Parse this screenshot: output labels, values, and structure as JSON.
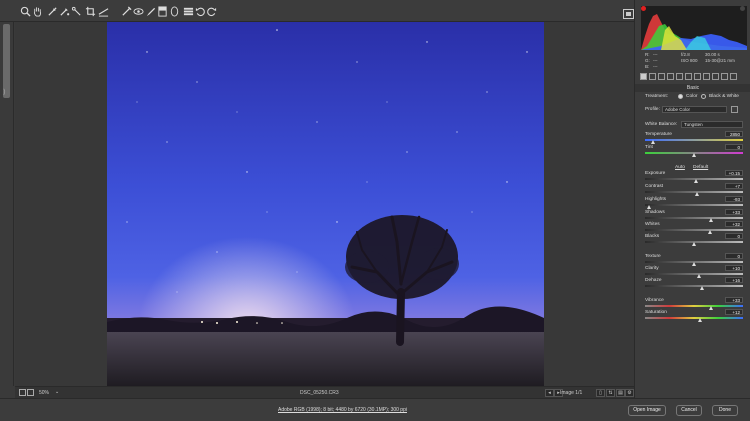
{
  "toolbar": {
    "tools": [
      "zoom-tool-icon",
      "hand-tool-icon",
      "white-balance-tool-icon",
      "color-sampler-tool-icon",
      "targeted-adjustment-tool-icon",
      "crop-tool-icon",
      "straighten-tool-icon",
      "spot-removal-tool-icon",
      "red-eye-tool-icon",
      "adjustment-brush-icon",
      "graduated-filter-icon",
      "radial-filter-icon",
      "preferences-icon",
      "rotate-ccw-icon",
      "rotate-cw-icon"
    ]
  },
  "info": {
    "r_label": "R:",
    "r_val": "---",
    "g_label": "G:",
    "g_val": "---",
    "b_label": "B:",
    "b_val": "---",
    "fstop": "f/2.8",
    "shutter": "30.00 s",
    "iso": "ISO 800",
    "lens": "15-30@21 mm"
  },
  "panel": {
    "section": "Basic",
    "treatment_label": "Treatment:",
    "treatment_color": "Color",
    "treatment_bw": "Black & White",
    "profile_label": "Profile:",
    "profile_value": "Adobe Color",
    "wb_label": "White Balance:",
    "wb_value": "Tungsten",
    "auto": "Auto",
    "default": "Default",
    "sliders": [
      {
        "label": "Temperature",
        "value": "2850",
        "pos": 0.08
      },
      {
        "label": "Tint",
        "value": "0",
        "pos": 0.5
      },
      {
        "label": "Exposure",
        "value": "+0.15",
        "pos": 0.52
      },
      {
        "label": "Contrast",
        "value": "+7",
        "pos": 0.53
      },
      {
        "label": "Highlights",
        "value": "-93",
        "pos": 0.04
      },
      {
        "label": "Shadows",
        "value": "+33",
        "pos": 0.67
      },
      {
        "label": "Whites",
        "value": "+32",
        "pos": 0.66
      },
      {
        "label": "Blacks",
        "value": "0",
        "pos": 0.5
      },
      {
        "label": "Texture",
        "value": "0",
        "pos": 0.5
      },
      {
        "label": "Clarity",
        "value": "+10",
        "pos": 0.55
      },
      {
        "label": "Dehaze",
        "value": "+16",
        "pos": 0.58
      },
      {
        "label": "Vibrance",
        "value": "+33",
        "pos": 0.67
      },
      {
        "label": "Saturation",
        "value": "+12",
        "pos": 0.56
      }
    ]
  },
  "status": {
    "zoom": "50%",
    "filename": "DSC_05250.CR3",
    "image_count": "Image 1/1"
  },
  "bottom": {
    "workflow": "Adobe RGB (1998); 8 bit; 4480 by 6720 (30.1MP); 300 ppi",
    "open": "Open Image",
    "cancel": "Cancel",
    "done": "Done"
  },
  "colors": {
    "sky_top": "#2f36b4",
    "sky_mid": "#4a5ee0",
    "horizon": "#b99ad6"
  }
}
